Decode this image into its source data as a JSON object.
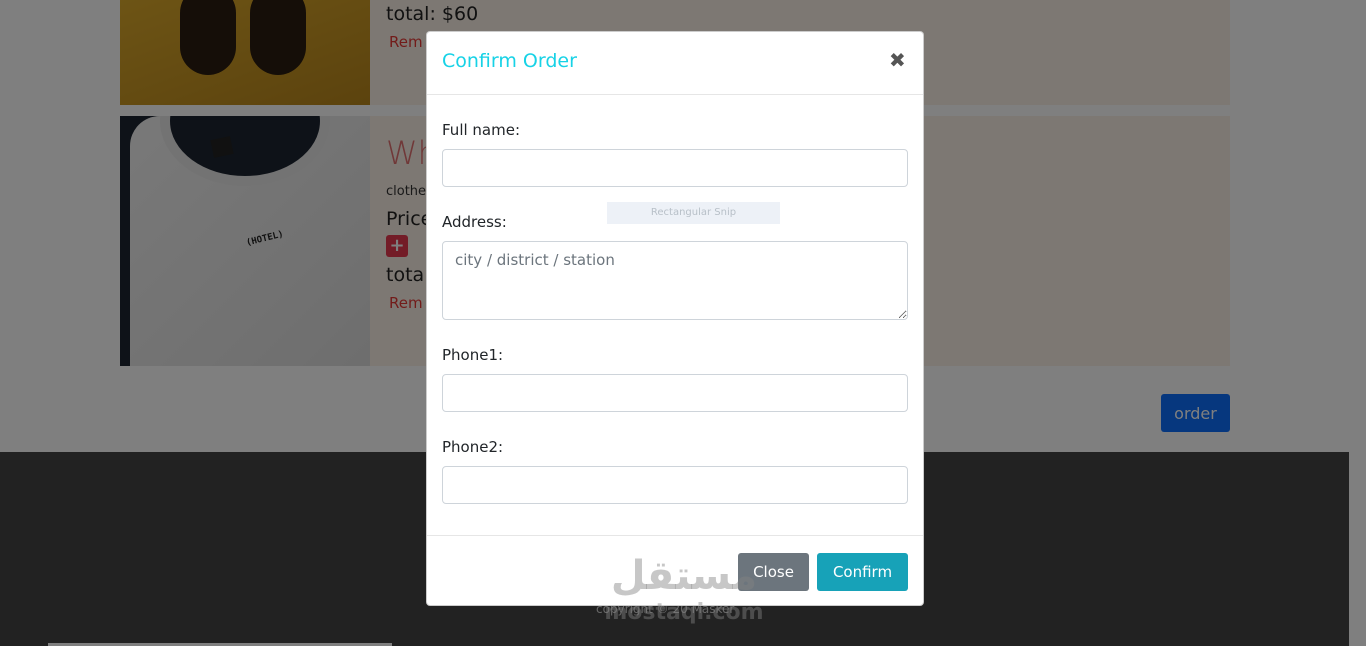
{
  "cart": {
    "item1": {
      "total": "total: $60",
      "remove_label": "Rem"
    },
    "item2": {
      "name": "Wh",
      "category": "clothe",
      "price_label": "Price",
      "add_icon": "plus-square-icon",
      "total": "tota",
      "remove_label": "Rem",
      "shirt_print": "(HOTEL)"
    },
    "order_label": "order"
  },
  "footer": {
    "copyright": "copyright © 20 Masker"
  },
  "modal": {
    "title": "Confirm Order",
    "close_icon": "close-x-icon",
    "fields": {
      "full_name": {
        "label": "Full name:",
        "value": ""
      },
      "address": {
        "label": "Address:",
        "placeholder": "city / district / station"
      },
      "phone1": {
        "label": "Phone1:",
        "value": ""
      },
      "phone2": {
        "label": "Phone2:",
        "value": ""
      }
    },
    "close_label": "Close",
    "confirm_label": "Confirm"
  },
  "overlay": {
    "snip_tooltip": "Rectangular Snip"
  },
  "watermark": {
    "arabic": "مستقل",
    "latin": "mostaqi.com"
  },
  "colors": {
    "title_accent": "#17d2e6",
    "confirm_button": "#17a2b8",
    "close_button": "#6c757d",
    "order_button": "#0d6efd",
    "remove_text": "#e53935",
    "footer_bg": "#454545"
  }
}
